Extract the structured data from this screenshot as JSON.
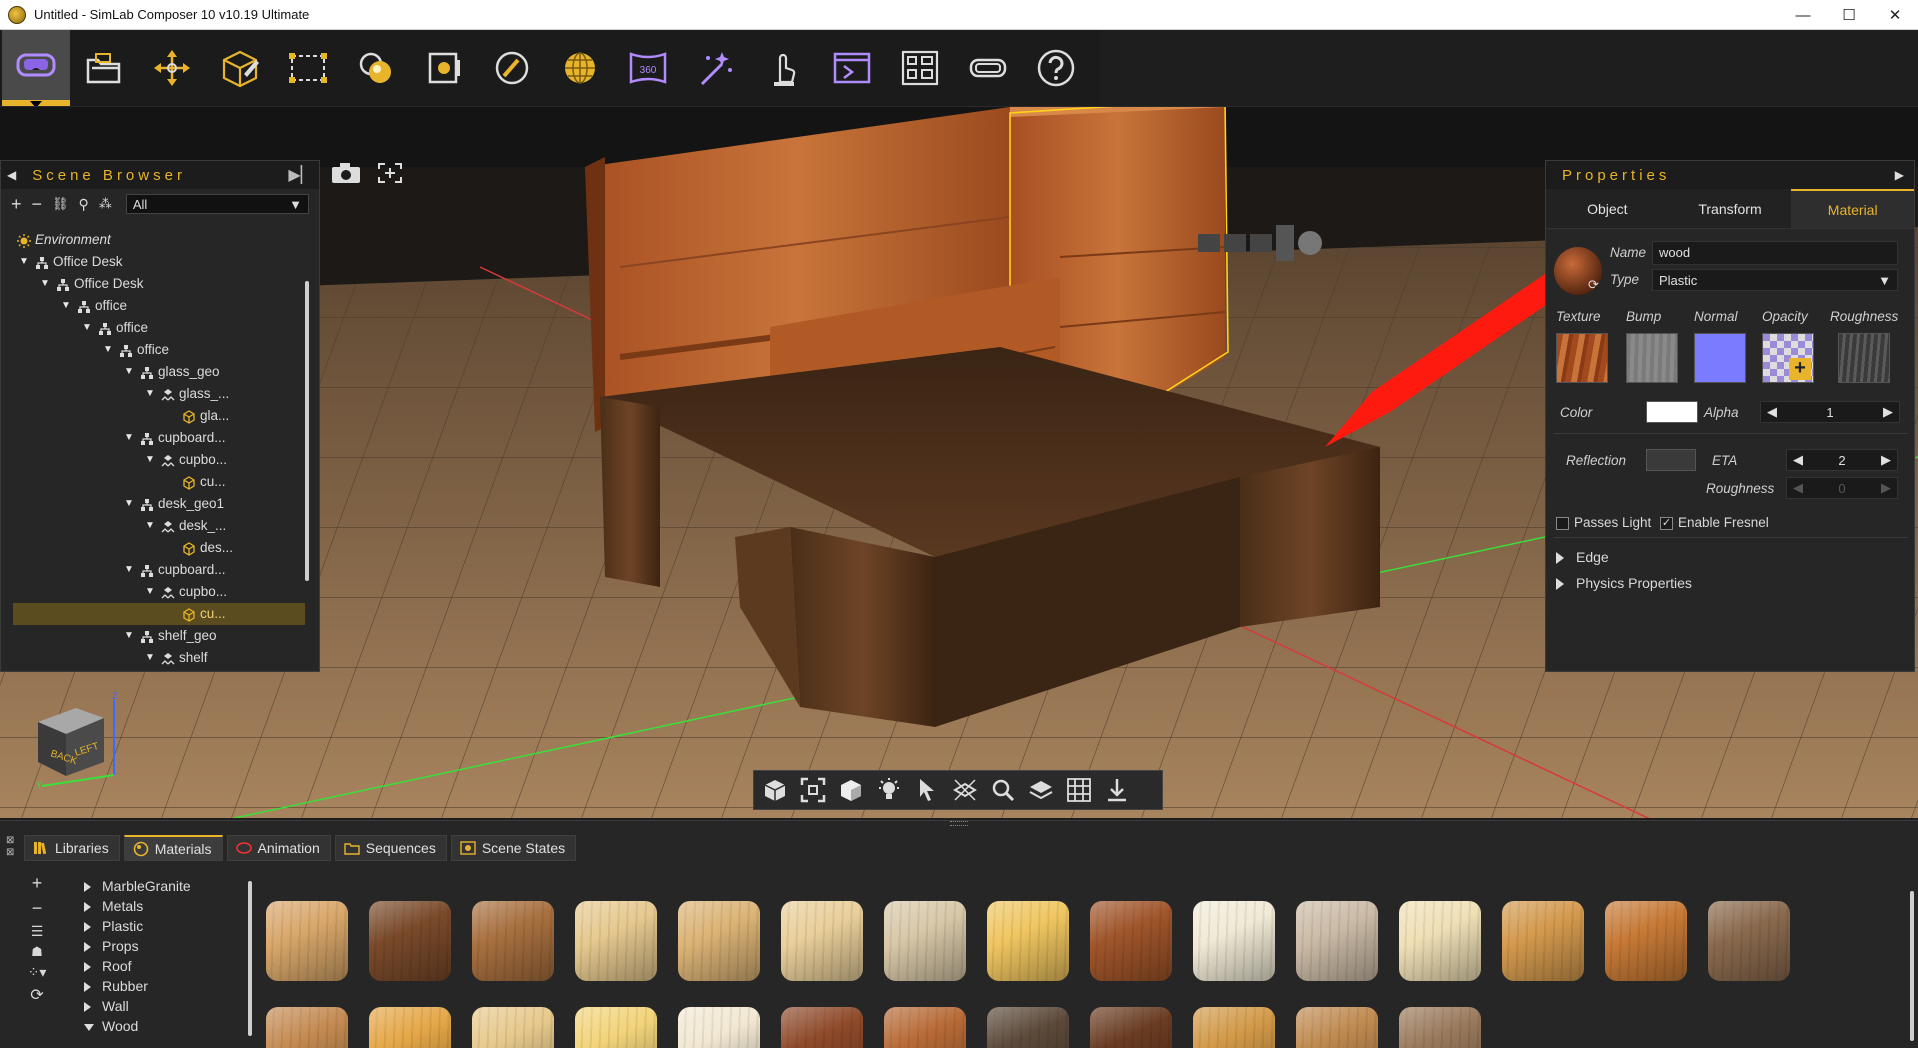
{
  "window": {
    "title": "Untitled - SimLab Composer 10 v10.19 Ultimate",
    "controls": [
      "—",
      "☐",
      "✕"
    ]
  },
  "toolbar": {
    "tools": [
      {
        "name": "vr-headset-tool",
        "active": true
      },
      {
        "name": "open-file-tool"
      },
      {
        "name": "transform-tool"
      },
      {
        "name": "edit-box-tool"
      },
      {
        "name": "selection-tool"
      },
      {
        "name": "materials-tool"
      },
      {
        "name": "render-tool"
      },
      {
        "name": "pen-tool"
      },
      {
        "name": "environment-tool"
      },
      {
        "name": "panorama-360-tool"
      },
      {
        "name": "magic-wand-tool"
      },
      {
        "name": "interaction-tool"
      },
      {
        "name": "presentation-tool"
      },
      {
        "name": "layout-tool"
      },
      {
        "name": "vr-viewer-tool"
      },
      {
        "name": "help-tool"
      }
    ],
    "vr360_label": "360"
  },
  "scene_browser": {
    "title": "Scene Browser",
    "filter": "All",
    "tree": [
      {
        "label": "Environment",
        "depth": 0,
        "arrow": "",
        "icon": "sun",
        "env": true
      },
      {
        "label": "Office Desk",
        "depth": 0,
        "arrow": "▼",
        "icon": "group"
      },
      {
        "label": "Office Desk",
        "depth": 1,
        "arrow": "▼",
        "icon": "group"
      },
      {
        "label": "office",
        "depth": 2,
        "arrow": "▼",
        "icon": "group"
      },
      {
        "label": "office",
        "depth": 3,
        "arrow": "▼",
        "icon": "group"
      },
      {
        "label": "office",
        "depth": 4,
        "arrow": "▼",
        "icon": "group"
      },
      {
        "label": "glass_geo",
        "depth": 5,
        "arrow": "▼",
        "icon": "group"
      },
      {
        "label": "glass_...",
        "depth": 6,
        "arrow": "▼",
        "icon": "mesh-group"
      },
      {
        "label": "gla...",
        "depth": 7,
        "arrow": "",
        "icon": "mesh"
      },
      {
        "label": "cupboard...",
        "depth": 5,
        "arrow": "▼",
        "icon": "group"
      },
      {
        "label": "cupbo...",
        "depth": 6,
        "arrow": "▼",
        "icon": "mesh-group"
      },
      {
        "label": "cu...",
        "depth": 7,
        "arrow": "",
        "icon": "mesh"
      },
      {
        "label": "desk_geo1",
        "depth": 5,
        "arrow": "▼",
        "icon": "group"
      },
      {
        "label": "desk_...",
        "depth": 6,
        "arrow": "▼",
        "icon": "mesh-group"
      },
      {
        "label": "des...",
        "depth": 7,
        "arrow": "",
        "icon": "mesh"
      },
      {
        "label": "cupboard...",
        "depth": 5,
        "arrow": "▼",
        "icon": "group"
      },
      {
        "label": "cupbo...",
        "depth": 6,
        "arrow": "▼",
        "icon": "mesh-group"
      },
      {
        "label": "cu...",
        "depth": 7,
        "arrow": "",
        "icon": "mesh",
        "selected": true
      },
      {
        "label": "shelf_geo",
        "depth": 5,
        "arrow": "▼",
        "icon": "group"
      },
      {
        "label": "shelf",
        "depth": 6,
        "arrow": "▼",
        "icon": "mesh-group"
      }
    ]
  },
  "properties": {
    "title": "Properties",
    "tabs": [
      {
        "label": "Object"
      },
      {
        "label": "Transform"
      },
      {
        "label": "Material",
        "active": true
      }
    ],
    "name_label": "Name",
    "name_value": "wood",
    "type_label": "Type",
    "type_value": "Plastic",
    "maps": [
      "Texture",
      "Bump",
      "Normal",
      "Opacity",
      "Roughness"
    ],
    "color_label": "Color",
    "alpha_label": "Alpha",
    "alpha_value": "1",
    "reflection_label": "Reflection",
    "eta_label": "ETA",
    "eta_value": "2",
    "roughness_label": "Roughness",
    "roughness_value": "0",
    "passes_light_label": "Passes Light",
    "passes_light_checked": false,
    "fresnel_label": "Enable Fresnel",
    "fresnel_checked": true,
    "sections": [
      "Edge",
      "Physics Properties"
    ],
    "colors": {
      "normal": "#7b7bff",
      "color": "#ffffff",
      "reflection": "#3a3a3a",
      "bump": "#808080"
    }
  },
  "nav_cube": {
    "back": "BACK",
    "left": "LEFT",
    "axis_z": "Z",
    "axis_y": "Y"
  },
  "bottom_panel": {
    "tabs": [
      {
        "label": "Libraries"
      },
      {
        "label": "Materials",
        "active": true
      },
      {
        "label": "Animation"
      },
      {
        "label": "Sequences"
      },
      {
        "label": "Scene States"
      }
    ],
    "categories": [
      {
        "label": "MarbleGranite",
        "open": false
      },
      {
        "label": "Metals",
        "open": false
      },
      {
        "label": "Plastic",
        "open": false
      },
      {
        "label": "Props",
        "open": false
      },
      {
        "label": "Roof",
        "open": false
      },
      {
        "label": "Rubber",
        "open": false
      },
      {
        "label": "Wall",
        "open": false
      },
      {
        "label": "Wood",
        "open": true
      }
    ],
    "materials_row1": [
      "#d9a76a",
      "#7a4a2a",
      "#a8703f",
      "#e6c98f",
      "#dcb476",
      "#e9cf9a",
      "#d8c8a8",
      "#f0c660",
      "#a0552a",
      "#f1ead6",
      "#cbbba6",
      "#f0e0b6",
      "#d49a4e",
      "#c77a36",
      "#8a6a4e"
    ],
    "materials_row2": [
      "#c58b52",
      "#e5a747",
      "#e7c98c",
      "#f3d47a",
      "#f2e8d2",
      "#8f4a2a",
      "#b76a36",
      "#5c4a3a",
      "#6a3c22",
      "#d29a48",
      "#c08a50",
      "#9a7a5c"
    ]
  },
  "accent": "#e7b42c"
}
